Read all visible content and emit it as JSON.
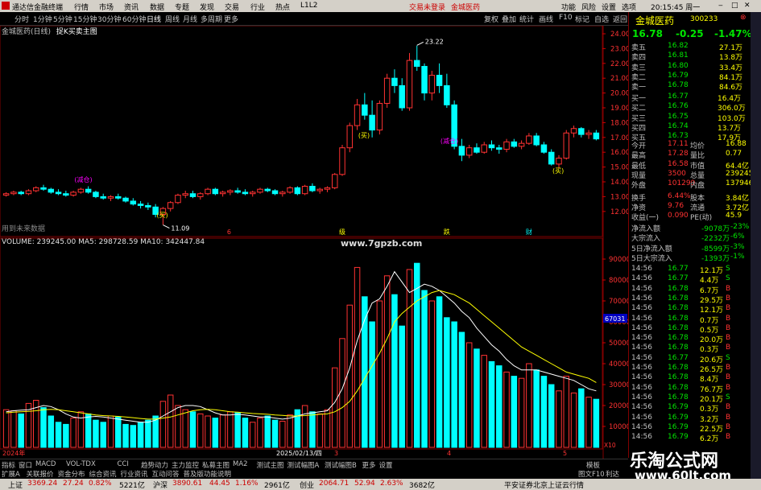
{
  "titlebar": {
    "app": "通达信金融终端",
    "menu": [
      "行情",
      "市场",
      "资讯",
      "数据",
      "专题",
      "发现",
      "交易",
      "行业",
      "热点",
      "L1L2"
    ],
    "trade": "交易未登录",
    "stock": "金城医药",
    "right": [
      "功能",
      "风险",
      "设置",
      "选项"
    ],
    "clock": "20:15:45 周一"
  },
  "toolbar": {
    "items": [
      "分时",
      "1分钟",
      "5分钟",
      "15分钟",
      "30分钟",
      "60分钟",
      "日线",
      "周线",
      "月线",
      "多周期",
      "更多"
    ],
    "right": [
      "复权",
      "叠加",
      "统计",
      "画线",
      "F10",
      "标记",
      "自选",
      "返回"
    ]
  },
  "chart": {
    "info": "金城医药(日线)",
    "formula": "捉K买卖主图",
    "hint": "用到未来数据",
    "high_label": "23.22",
    "low_label": "11.09",
    "vol_info": "VOLUME: 239245.00  MA5: 298728.59  MA10: 342447.84",
    "watermark": "www.7gpzb.com",
    "marker": "67031",
    "dates": [
      "2024年",
      "2025/02/13/四",
      "3",
      "4",
      "5"
    ],
    "x10": "X10",
    "ann": [
      "(减仓)",
      "(买)",
      "(买)",
      "(减仓)",
      "(买)"
    ],
    "ev": [
      "6",
      "级",
      "跌",
      "财"
    ]
  },
  "chart_data": {
    "type": "candlestick",
    "price_axis": [
      24.0,
      23.0,
      22.0,
      21.0,
      20.0,
      19.0,
      18.0,
      17.0,
      16.0,
      15.0,
      14.0,
      13.0,
      12.0
    ],
    "vol_axis": [
      90000,
      80000,
      70000,
      60000,
      50000,
      40000,
      30000,
      20000,
      10000
    ],
    "candles": [
      [
        13.1,
        13.3,
        13.0,
        13.2
      ],
      [
        13.2,
        13.4,
        13.1,
        13.3
      ],
      [
        13.3,
        13.4,
        13.1,
        13.2
      ],
      [
        13.2,
        13.5,
        13.1,
        13.4
      ],
      [
        13.4,
        13.7,
        13.3,
        13.6
      ],
      [
        13.6,
        13.8,
        13.4,
        13.5
      ],
      [
        13.5,
        13.6,
        13.2,
        13.3
      ],
      [
        13.3,
        13.5,
        13.1,
        13.2
      ],
      [
        13.2,
        13.4,
        13.0,
        13.1
      ],
      [
        13.1,
        13.4,
        13.0,
        13.3
      ],
      [
        13.3,
        13.6,
        13.2,
        13.5
      ],
      [
        13.5,
        13.7,
        13.2,
        13.3
      ],
      [
        13.3,
        13.4,
        12.9,
        13.0
      ],
      [
        13.0,
        13.2,
        12.8,
        12.9
      ],
      [
        12.9,
        13.1,
        12.7,
        13.0
      ],
      [
        13.0,
        13.2,
        12.8,
        12.9
      ],
      [
        12.9,
        13.0,
        12.6,
        12.7
      ],
      [
        12.7,
        12.9,
        12.4,
        12.5
      ],
      [
        12.5,
        12.7,
        12.2,
        12.4
      ],
      [
        12.4,
        12.6,
        12.1,
        12.3
      ],
      [
        12.3,
        12.5,
        11.6,
        11.8
      ],
      [
        11.8,
        12.3,
        11.1,
        12.2
      ],
      [
        12.2,
        12.7,
        12.0,
        12.6
      ],
      [
        12.6,
        13.2,
        12.5,
        13.1
      ],
      [
        13.1,
        13.4,
        12.9,
        13.2
      ],
      [
        13.2,
        13.4,
        12.9,
        13.0
      ],
      [
        13.0,
        13.3,
        12.8,
        13.2
      ],
      [
        13.2,
        13.6,
        13.1,
        13.5
      ],
      [
        13.5,
        13.6,
        13.1,
        13.2
      ],
      [
        13.2,
        13.4,
        13.0,
        13.3
      ],
      [
        13.3,
        13.5,
        13.1,
        13.4
      ],
      [
        13.4,
        13.6,
        13.2,
        13.3
      ],
      [
        13.3,
        13.5,
        13.1,
        13.2
      ],
      [
        13.2,
        13.4,
        13.0,
        13.3
      ],
      [
        13.3,
        13.6,
        13.2,
        13.5
      ],
      [
        13.5,
        13.6,
        13.3,
        13.4
      ],
      [
        13.4,
        13.5,
        13.1,
        13.2
      ],
      [
        13.2,
        13.4,
        13.0,
        13.3
      ],
      [
        13.3,
        13.7,
        13.2,
        13.6
      ],
      [
        13.6,
        13.7,
        13.1,
        13.2
      ],
      [
        13.2,
        13.8,
        13.1,
        13.7
      ],
      [
        13.7,
        13.9,
        13.3,
        13.4
      ],
      [
        13.4,
        13.6,
        13.2,
        13.5
      ],
      [
        13.5,
        13.7,
        13.3,
        13.6
      ],
      [
        13.6,
        14.6,
        13.5,
        14.5
      ],
      [
        14.5,
        16.5,
        14.4,
        16.3
      ],
      [
        16.3,
        18.0,
        16.0,
        17.8
      ],
      [
        17.8,
        19.6,
        17.5,
        19.2
      ],
      [
        19.2,
        20.0,
        18.2,
        18.5
      ],
      [
        18.5,
        19.5,
        17.0,
        17.5
      ],
      [
        17.5,
        19.5,
        17.2,
        19.3
      ],
      [
        19.3,
        21.3,
        19.0,
        21.0
      ],
      [
        21.0,
        21.6,
        20.0,
        20.5
      ],
      [
        20.5,
        21.0,
        18.8,
        19.0
      ],
      [
        19.0,
        22.7,
        18.8,
        22.2
      ],
      [
        22.2,
        23.2,
        21.5,
        21.8
      ],
      [
        21.8,
        22.0,
        19.5,
        20.0
      ],
      [
        20.0,
        21.5,
        19.5,
        21.2
      ],
      [
        21.2,
        22.0,
        20.0,
        20.5
      ],
      [
        20.5,
        21.3,
        19.0,
        19.2
      ],
      [
        19.2,
        19.5,
        16.2,
        16.4
      ],
      [
        16.4,
        16.9,
        15.4,
        15.8
      ],
      [
        15.8,
        16.5,
        15.6,
        16.3
      ],
      [
        16.3,
        16.6,
        15.9,
        16.0
      ],
      [
        16.0,
        16.7,
        15.9,
        16.5
      ],
      [
        16.5,
        16.8,
        16.1,
        16.3
      ],
      [
        16.3,
        16.5,
        15.9,
        16.2
      ],
      [
        16.2,
        16.9,
        16.0,
        16.7
      ],
      [
        16.7,
        16.9,
        16.3,
        16.4
      ],
      [
        16.4,
        16.8,
        16.2,
        16.6
      ],
      [
        16.6,
        17.3,
        16.5,
        17.1
      ],
      [
        17.1,
        17.3,
        16.4,
        16.5
      ],
      [
        16.5,
        16.7,
        15.9,
        16.0
      ],
      [
        16.0,
        16.2,
        15.1,
        15.2
      ],
      [
        15.2,
        15.8,
        14.9,
        15.6
      ],
      [
        15.6,
        17.5,
        15.5,
        17.3
      ],
      [
        17.3,
        17.8,
        17.0,
        17.6
      ],
      [
        17.6,
        17.7,
        17.0,
        17.2
      ],
      [
        17.2,
        17.5,
        16.9,
        17.3
      ],
      [
        17.3,
        17.5,
        16.8,
        16.9
      ]
    ],
    "volumes": [
      18000,
      17500,
      16000,
      21000,
      22500,
      19000,
      15000,
      12000,
      11000,
      14000,
      17000,
      16000,
      13000,
      12000,
      15000,
      14500,
      11000,
      10500,
      12000,
      13000,
      15000,
      22000,
      25000,
      20000,
      18000,
      17000,
      16000,
      15000,
      14000,
      15500,
      17000,
      16500,
      14000,
      12000,
      14000,
      15000,
      13000,
      12500,
      15500,
      18000,
      20000,
      17000,
      16000,
      18000,
      38000,
      52000,
      68000,
      86000,
      72000,
      60000,
      70000,
      82000,
      73000,
      58000,
      85000,
      88000,
      75000,
      70000,
      72000,
      62000,
      60000,
      55000,
      50000,
      47000,
      44000,
      41000,
      39000,
      36000,
      34000,
      33000,
      40000,
      37000,
      34000,
      30000,
      27000,
      34000,
      26000,
      28000,
      24000,
      23000
    ],
    "ma5": [
      17000,
      17500,
      17800,
      18000,
      19000,
      20000,
      19500,
      18000,
      16000,
      14500,
      14000,
      14500,
      14800,
      14500,
      14000,
      13500,
      13000,
      12500,
      12000,
      12000,
      13000,
      15000,
      17000,
      19000,
      20000,
      20000,
      19500,
      18000,
      16500,
      15500,
      15500,
      15800,
      15500,
      15000,
      14500,
      14500,
      14000,
      13500,
      14000,
      15000,
      16000,
      16500,
      17000,
      17500,
      21500,
      28000,
      38000,
      51000,
      61000,
      69000,
      71000,
      77000,
      84000,
      79000,
      74000,
      76000,
      78000,
      77000,
      75000,
      72000,
      69000,
      65000,
      62000,
      57000,
      53000,
      49000,
      46000,
      42000,
      39000,
      37000,
      37000,
      37000,
      36000,
      35000,
      34000,
      33000,
      32000,
      30000,
      28000,
      27000
    ],
    "ma10": [
      16500,
      16800,
      17000,
      17200,
      17500,
      18000,
      18200,
      18000,
      17500,
      17000,
      16500,
      16000,
      15500,
      15200,
      15000,
      14800,
      14500,
      14200,
      13800,
      13500,
      13500,
      14000,
      14500,
      15500,
      16500,
      17500,
      18000,
      18200,
      18000,
      17500,
      17000,
      16800,
      16500,
      16200,
      16000,
      15800,
      15500,
      15300,
      15000,
      15000,
      15200,
      15500,
      15800,
      16000,
      17000,
      19000,
      22000,
      27000,
      33000,
      39000,
      45000,
      52000,
      60000,
      64000,
      67000,
      70000,
      72000,
      74000,
      75000,
      74000,
      73000,
      71000,
      69000,
      66000,
      63000,
      60000,
      57000,
      54000,
      51000,
      48000,
      46000,
      44000,
      42000,
      40000,
      38000,
      36000,
      35000,
      34000,
      33000,
      31000
    ]
  },
  "quote": {
    "name": "金城医药",
    "code": "300233",
    "price": "16.78",
    "change": "-0.25",
    "pct": "-1.47%",
    "asks": [
      [
        "卖五",
        "16.82",
        "27.1万"
      ],
      [
        "卖四",
        "16.81",
        "13.8万"
      ],
      [
        "卖三",
        "16.80",
        "33.4万"
      ],
      [
        "卖二",
        "16.79",
        "84.1万"
      ],
      [
        "卖一",
        "16.78",
        "84.6万"
      ]
    ],
    "bids": [
      [
        "买一",
        "16.77",
        "16.4万"
      ],
      [
        "买二",
        "16.76",
        "306.0万"
      ],
      [
        "买三",
        "16.75",
        "103.0万"
      ],
      [
        "买四",
        "16.74",
        "13.7万"
      ],
      [
        "买五",
        "16.73",
        "17.9万"
      ]
    ],
    "stats": [
      [
        "今开",
        "17.11",
        "均价",
        "16.88"
      ],
      [
        "最高",
        "17.28",
        "量比",
        "0.77"
      ],
      [
        "最低",
        "16.58",
        "市值",
        "64.4亿"
      ],
      [
        "现量",
        "3500",
        "总量",
        "239245"
      ],
      [
        "外盘",
        "101299",
        "内盘",
        "137946"
      ],
      [
        "换手",
        "6.44%",
        "股本",
        "3.84亿"
      ],
      [
        "净资",
        "9.76",
        "流通",
        "3.72亿"
      ],
      [
        "收益(一)",
        "0.090",
        "PE(动)",
        "45.9"
      ]
    ],
    "flows": [
      [
        "净流入额",
        "-9078万",
        "-23%"
      ],
      [
        "大宗流入",
        "-2232万",
        "-6%"
      ],
      [
        "5日净流入额",
        "-8599万",
        "-3%"
      ],
      [
        "5日大宗流入",
        "-1393万",
        "-1%"
      ]
    ],
    "ticks": [
      [
        "14:56",
        "16.77",
        "12.1万",
        "S"
      ],
      [
        "14:56",
        "16.77",
        "4.4万",
        "S"
      ],
      [
        "14:56",
        "16.78",
        "6.7万",
        "B"
      ],
      [
        "14:56",
        "16.78",
        "29.5万",
        "B"
      ],
      [
        "14:56",
        "16.78",
        "12.1万",
        "B"
      ],
      [
        "14:56",
        "16.78",
        "0.7万",
        "B"
      ],
      [
        "14:56",
        "16.78",
        "0.5万",
        "B"
      ],
      [
        "14:56",
        "16.78",
        "20.0万",
        "B"
      ],
      [
        "14:56",
        "16.78",
        "0.3万",
        "B"
      ],
      [
        "14:56",
        "16.77",
        "20.6万",
        "S"
      ],
      [
        "14:56",
        "16.78",
        "26.5万",
        "B"
      ],
      [
        "14:56",
        "16.78",
        "8.4万",
        "B"
      ],
      [
        "14:56",
        "16.78",
        "76.7万",
        "B"
      ],
      [
        "14:56",
        "16.78",
        "20.1万",
        "S"
      ],
      [
        "14:56",
        "16.79",
        "0.3万",
        "B"
      ],
      [
        "14:56",
        "16.79",
        "3.2万",
        "B"
      ],
      [
        "14:56",
        "16.79",
        "22.5万",
        "B"
      ],
      [
        "14:56",
        "16.79",
        "6.2万",
        "B"
      ]
    ]
  },
  "tabs": [
    "指标",
    "窗口",
    "MACD",
    "VOL-TDX",
    "CCI",
    "趋势动力",
    "主力监控",
    "私募主图",
    "MA2",
    "测试主图",
    "测试幅图A",
    "测试幅图B",
    "更多",
    "设置"
  ],
  "tabs2": [
    "扩展A",
    "关联报价",
    "资金分布",
    "综合资讯",
    "行业资讯",
    "互动问答",
    "普及版功能说明"
  ],
  "tabs_right": [
    "模板",
    "图文F10",
    "利达"
  ],
  "status": {
    "sh_label": "上证",
    "sh_val": "3369.24",
    "sh_chg": "27.24",
    "sh_pct": "0.82%",
    "sh_amt": "5221亿",
    "sz_label": "沪深",
    "sz_val": "3890.61",
    "sz_chg": "44.45",
    "sz_pct": "1.16%",
    "sz_amt": "2961亿",
    "cy_label": "创业",
    "cy_val": "2064.71",
    "cy_chg": "52.94",
    "cy_pct": "2.63%",
    "cy_amt": "3682亿",
    "broker": "平安证券北京上证云行情"
  },
  "brand": {
    "name": "乐淘公式网",
    "url": "www.60lt.com"
  }
}
